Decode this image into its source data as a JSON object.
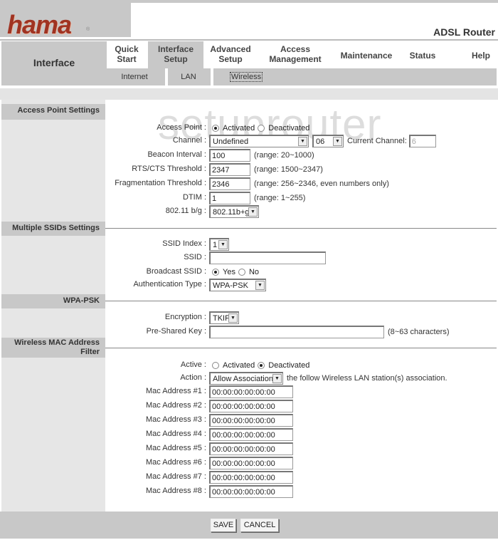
{
  "header": {
    "brand": "hama",
    "brand_mark": "®",
    "product": "ADSL Router",
    "accent_color": "#a03322"
  },
  "nav": {
    "section_label": "Interface",
    "tabs": [
      {
        "line1": "Quick",
        "line2": "Start"
      },
      {
        "line1": "Interface",
        "line2": "Setup",
        "active": true
      },
      {
        "line1": "Advanced",
        "line2": "Setup"
      },
      {
        "line1": "Access",
        "line2": "Management"
      },
      {
        "line1": "Maintenance",
        "line2": ""
      },
      {
        "line1": "Status",
        "line2": ""
      },
      {
        "line1": "Help",
        "line2": ""
      }
    ],
    "subtabs": [
      {
        "label": "Internet"
      },
      {
        "label": "LAN"
      },
      {
        "label": "Wireless",
        "active": true
      }
    ]
  },
  "watermark": "setuprouter",
  "access_point": {
    "section_label": "Access Point Settings",
    "access_point_label": "Access Point :",
    "activated_label": "Activated",
    "deactivated_label": "Deactivated",
    "access_point_value": "Activated",
    "channel_label": "Channel :",
    "channel_region": "Undefined",
    "channel_number": "06",
    "current_channel_label": "Current Channel:",
    "current_channel_value": "6",
    "beacon_label": "Beacon Interval :",
    "beacon_value": "100",
    "beacon_range": "(range: 20~1000)",
    "rts_label": "RTS/CTS Threshold :",
    "rts_value": "2347",
    "rts_range": "(range: 1500~2347)",
    "frag_label": "Fragmentation Threshold :",
    "frag_value": "2346",
    "frag_range": "(range: 256~2346, even numbers only)",
    "dtim_label": "DTIM :",
    "dtim_value": "1",
    "dtim_range": "(range: 1~255)",
    "mode_label": "802.11 b/g :",
    "mode_value": "802.11b+g"
  },
  "ssids": {
    "section_label": "Multiple SSIDs Settings",
    "index_label": "SSID Index :",
    "index_value": "1",
    "ssid_label": "SSID :",
    "ssid_value": "",
    "broadcast_label": "Broadcast SSID :",
    "yes_label": "Yes",
    "no_label": "No",
    "broadcast_value": "Yes",
    "auth_label": "Authentication Type :",
    "auth_value": "WPA-PSK"
  },
  "wpa": {
    "section_label": "WPA-PSK",
    "encryption_label": "Encryption :",
    "encryption_value": "TKIP",
    "psk_label": "Pre-Shared Key :",
    "psk_value": "",
    "psk_note": "(8~63 characters)"
  },
  "mac_filter": {
    "section_label_1": "Wireless MAC Address",
    "section_label_2": "Filter",
    "active_label": "Active :",
    "activated_label": "Activated",
    "deactivated_label": "Deactivated",
    "active_value": "Deactivated",
    "action_label": "Action :",
    "action_value": "Allow Association",
    "action_note": "the follow Wireless LAN station(s) association.",
    "addresses": [
      {
        "label": "Mac Address #1 :",
        "value": "00:00:00:00:00:00"
      },
      {
        "label": "Mac Address #2 :",
        "value": "00:00:00:00:00:00"
      },
      {
        "label": "Mac Address #3 :",
        "value": "00:00:00:00:00:00"
      },
      {
        "label": "Mac Address #4 :",
        "value": "00:00:00:00:00:00"
      },
      {
        "label": "Mac Address #5 :",
        "value": "00:00:00:00:00:00"
      },
      {
        "label": "Mac Address #6 :",
        "value": "00:00:00:00:00:00"
      },
      {
        "label": "Mac Address #7 :",
        "value": "00:00:00:00:00:00"
      },
      {
        "label": "Mac Address #8 :",
        "value": "00:00:00:00:00:00"
      }
    ]
  },
  "footer": {
    "save_label": "SAVE",
    "cancel_label": "CANCEL"
  }
}
